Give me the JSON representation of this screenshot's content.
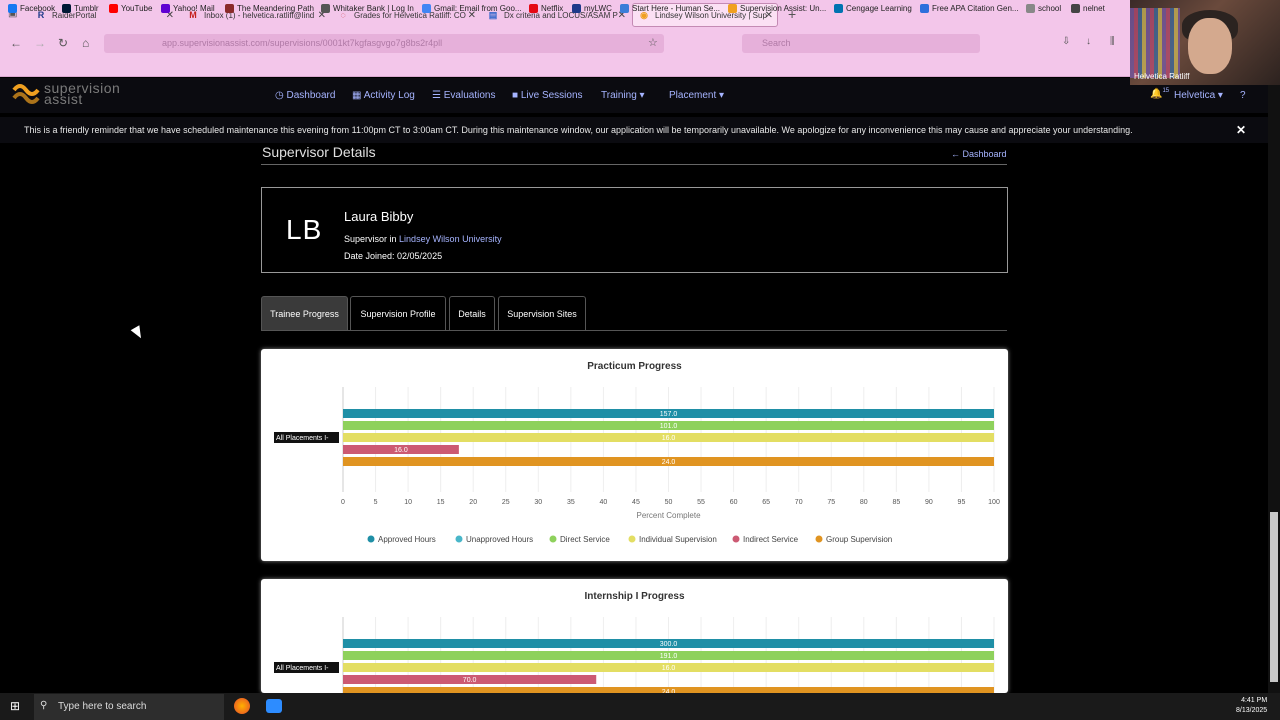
{
  "browser": {
    "tabs": [
      {
        "label": "RaiderPortal",
        "icon": "R",
        "color": "#1f3a8a"
      },
      {
        "label": "Inbox (1) - helvetica.ratliff@lind",
        "icon": "M",
        "color": "#c5221f"
      },
      {
        "label": "Grades for Helvetica Ratliff: CO",
        "icon": "◌",
        "color": "#c5221f"
      },
      {
        "label": "Dx criteria and LOCUS/ASAM P",
        "icon": "▤",
        "color": "#3366cc"
      },
      {
        "label": "Lindsey Wilson University | Sup",
        "icon": "◉",
        "color": "#f0a020"
      }
    ],
    "new_tab": "+",
    "url": "app.supervisionassist.com/supervisions/0001kt7kgfasgvgo7g8bs2r4pll",
    "search_placeholder": "Search",
    "bookmarks": [
      {
        "label": "Facebook",
        "color": "#1877f2"
      },
      {
        "label": "Tumblr",
        "color": "#001935"
      },
      {
        "label": "YouTube",
        "color": "#ff0000"
      },
      {
        "label": "Yahoo! Mail",
        "color": "#6001d2"
      },
      {
        "label": "The Meandering Path",
        "color": "#8a2a2a"
      },
      {
        "label": "Whitaker Bank | Log In",
        "color": "#555555"
      },
      {
        "label": "Gmail: Email from Goo...",
        "color": "#4285f4"
      },
      {
        "label": "Netflix",
        "color": "#e50914"
      },
      {
        "label": "myLWC",
        "color": "#1f3a8a"
      },
      {
        "label": "Start Here - Human Se...",
        "color": "#3b7dd8"
      },
      {
        "label": "Supervision Assist: Un...",
        "color": "#f0a020"
      },
      {
        "label": "Cengage Learning",
        "color": "#0073b1"
      },
      {
        "label": "Free APA Citation Gen...",
        "color": "#2d6fdc"
      },
      {
        "label": "school",
        "color": "#666666"
      },
      {
        "label": "nelnet",
        "color": "#444444"
      }
    ]
  },
  "app": {
    "logo_line1": "supervision",
    "logo_line2": "assist",
    "nav": [
      "Dashboard",
      "Activity Log",
      "Evaluations",
      "Live Sessions",
      "Training ▾",
      "Placement ▾"
    ],
    "user_label": "Helvetica ▾",
    "notif_count": "15",
    "banner": "This is a friendly reminder that we have scheduled maintenance this evening from 11:00pm CT to 3:00am CT. During this maintenance window, our application will be temporarily unavailable. We apologize for any inconvenience this may cause and appreciate your understanding.",
    "banner_close": "✕"
  },
  "page": {
    "title": "Supervisor Details",
    "back_link": "← Dashboard",
    "profile": {
      "initials": "LB",
      "name": "Laura Bibby",
      "role_prefix": "Supervisor in",
      "university": "Lindsey Wilson University",
      "date_joined": "Date Joined: 02/05/2025"
    },
    "tabs": [
      "Trainee Progress",
      "Supervision Profile",
      "Details",
      "Supervision Sites"
    ]
  },
  "chart_data": [
    {
      "type": "bar",
      "orientation": "horizontal",
      "title": "Practicum Progress",
      "categories": [
        "All Placements I-"
      ],
      "xlabel": "Percent Complete",
      "xlim": [
        0,
        100
      ],
      "xticks": [
        0,
        5,
        10,
        15,
        20,
        25,
        30,
        35,
        40,
        45,
        50,
        55,
        60,
        65,
        70,
        75,
        80,
        85,
        90,
        95,
        100
      ],
      "legend": "bottom",
      "series": [
        {
          "name": "Approved Hours",
          "percent": 100,
          "label": "157.0",
          "color": "#1f8fa6"
        },
        {
          "name": "Direct Service",
          "percent": 100,
          "label": "101.0",
          "color": "#8ed15c"
        },
        {
          "name": "Individual Supervision",
          "percent": 100,
          "label": "16.0",
          "color": "#e3de63"
        },
        {
          "name": "Indirect Service",
          "percent": 17.8,
          "label": "16.0",
          "color": "#cc5a73"
        },
        {
          "name": "Group Supervision",
          "percent": 100,
          "label": "24.0",
          "color": "#e09421"
        }
      ],
      "legend_entries": [
        {
          "name": "Approved Hours",
          "color": "#1f8fa6"
        },
        {
          "name": "Unapproved Hours",
          "color": "#48b6c9"
        },
        {
          "name": "Direct Service",
          "color": "#8ed15c"
        },
        {
          "name": "Individual Supervision",
          "color": "#e3de63"
        },
        {
          "name": "Indirect Service",
          "color": "#cc5a73"
        },
        {
          "name": "Group Supervision",
          "color": "#e09421"
        }
      ]
    },
    {
      "type": "bar",
      "orientation": "horizontal",
      "title": "Internship I Progress",
      "categories": [
        "All Placements I-"
      ],
      "xlim": [
        0,
        100
      ],
      "series": [
        {
          "name": "Approved Hours",
          "percent": 100,
          "label": "300.0",
          "color": "#1f8fa6"
        },
        {
          "name": "Direct Service",
          "percent": 100,
          "label": "191.0",
          "color": "#8ed15c"
        },
        {
          "name": "Individual Supervision",
          "percent": 100,
          "label": "16.0",
          "color": "#e3de63"
        },
        {
          "name": "Indirect Service",
          "percent": 38.9,
          "label": "70.0",
          "color": "#cc5a73"
        },
        {
          "name": "Group Supervision",
          "percent": 100,
          "label": "24.0",
          "color": "#e09421"
        }
      ]
    }
  ],
  "taskbar": {
    "search_placeholder": "Type here to search",
    "time": "4:41 PM",
    "date": "8/13/2025"
  },
  "webcam": {
    "name": "Helvetica Ratliff"
  }
}
